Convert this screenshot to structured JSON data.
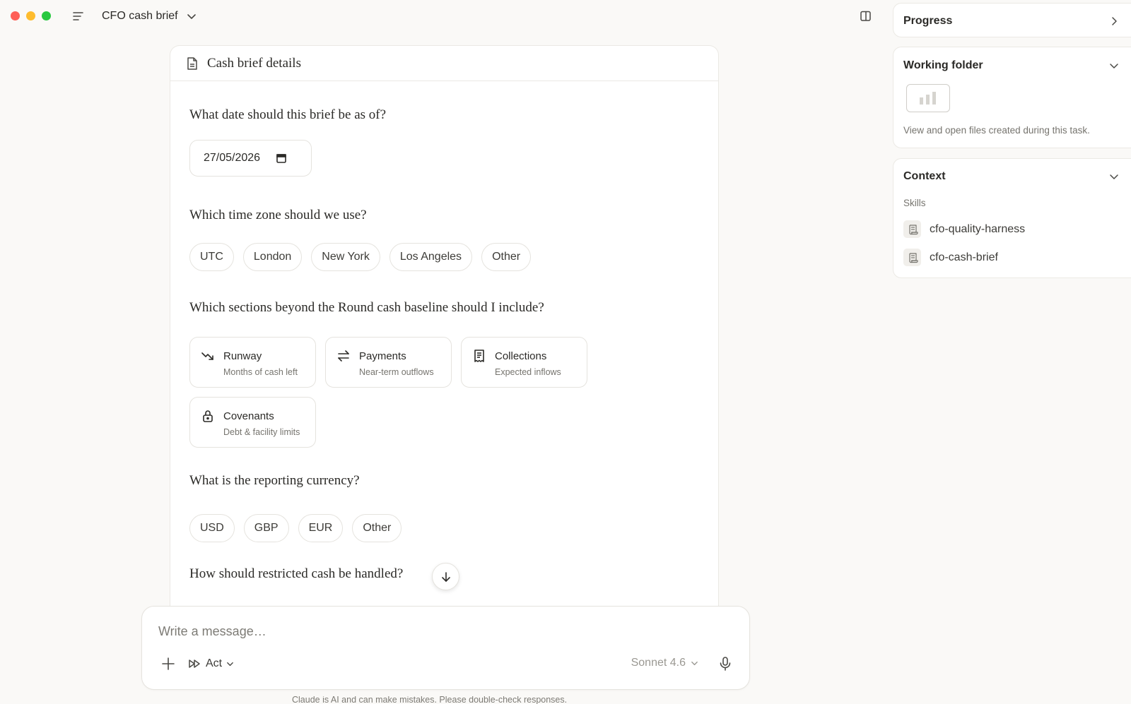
{
  "window": {
    "title": "CFO cash brief"
  },
  "card": {
    "title": "Cash brief details",
    "q_date": "What date should this brief be as of?",
    "date_value": "27/05/2026",
    "q_timezone": "Which time zone should we use?",
    "timezones": [
      "UTC",
      "London",
      "New York",
      "Los Angeles",
      "Other"
    ],
    "q_sections": "Which sections beyond the Round cash baseline should I include?",
    "sections": [
      {
        "label": "Runway",
        "sub": "Months of cash left",
        "icon": "trend-down-icon"
      },
      {
        "label": "Payments",
        "sub": "Near-term outflows",
        "icon": "swap-arrows-icon"
      },
      {
        "label": "Collections",
        "sub": "Expected inflows",
        "icon": "receipt-icon"
      },
      {
        "label": "Covenants",
        "sub": "Debt & facility limits",
        "icon": "lock-icon"
      }
    ],
    "q_currency": "What is the reporting currency?",
    "currencies": [
      "USD",
      "GBP",
      "EUR",
      "Other"
    ],
    "q_restricted": "How should restricted cash be handled?"
  },
  "composer": {
    "placeholder": "Write a message…",
    "mode": "Act",
    "model": "Sonnet 4.6"
  },
  "disclaimer": "Claude is AI and can make mistakes. Please double-check responses.",
  "sidebar": {
    "progress": {
      "title": "Progress"
    },
    "folder": {
      "title": "Working folder",
      "desc": "View and open files created during this task."
    },
    "context": {
      "title": "Context",
      "skills_label": "Skills",
      "skills": [
        "cfo-quality-harness",
        "cfo-cash-brief"
      ]
    }
  }
}
